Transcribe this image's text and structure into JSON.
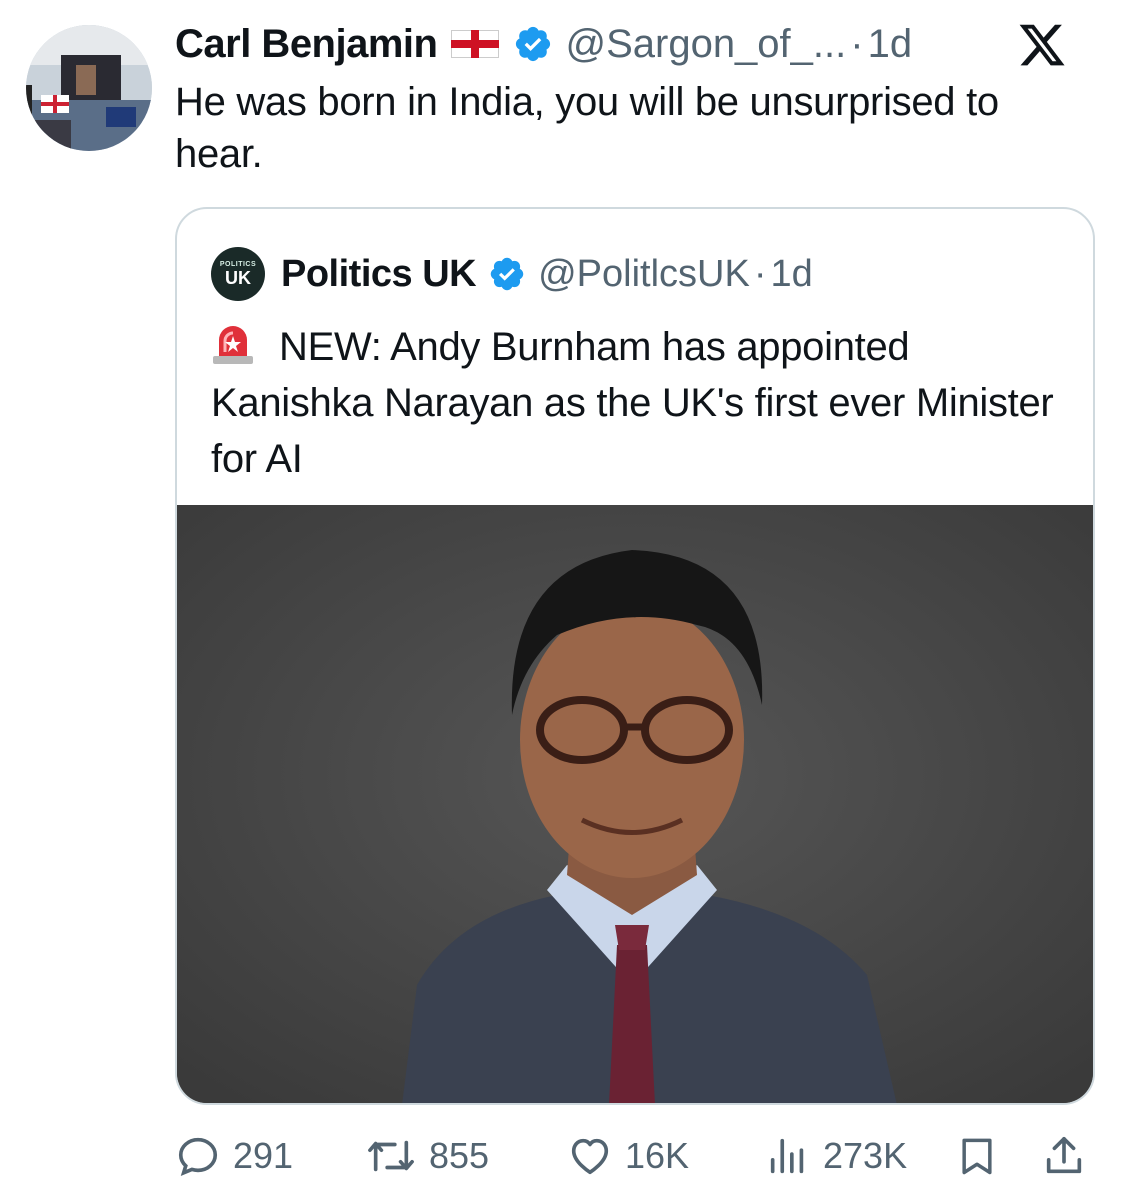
{
  "tweet": {
    "author_name": "Carl Benjamin",
    "author_handle": "@Sargon_of_...",
    "separator": "·",
    "time": "1d",
    "text": "He was born in India, you will be unsurprised to hear."
  },
  "quoted": {
    "author_name": "Politics UK",
    "author_handle": "@PolitlcsUK",
    "separator": "·",
    "time": "1d",
    "avatar_text_small": "POLITICS",
    "avatar_text_big": "UK",
    "text": "NEW: Andy Burnham has appointed Kanishka Narayan as the UK's first ever Minister for AI"
  },
  "metrics": {
    "replies": "291",
    "reposts": "855",
    "likes": "16K",
    "views": "273K"
  },
  "icons": {
    "flag": "england-flag-icon",
    "verified": "verified-badge-icon",
    "platform": "x-logo-icon",
    "siren": "police-siren-icon",
    "reply": "reply-icon",
    "repost": "repost-icon",
    "like": "like-icon",
    "views": "views-icon",
    "bookmark": "bookmark-icon",
    "share": "share-icon"
  },
  "colors": {
    "verified": "#1d9bf0",
    "secondary_text": "#536471",
    "border": "#cfd9de"
  }
}
